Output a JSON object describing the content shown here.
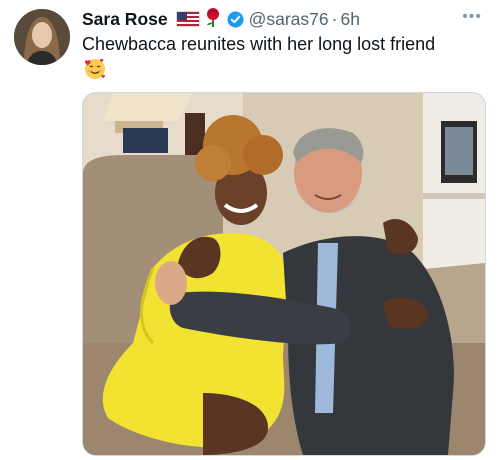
{
  "tweet": {
    "display_name": "Sara Rose",
    "handle": "@saras76",
    "separator": "·",
    "time": "6h",
    "text": "Chewbacca reunites with her long lost friend",
    "emoji": "smiling-face-with-hearts-icon",
    "more_label": "•••"
  },
  "colors": {
    "verified": "#1d9bf0",
    "secondary_text": "#536471"
  }
}
